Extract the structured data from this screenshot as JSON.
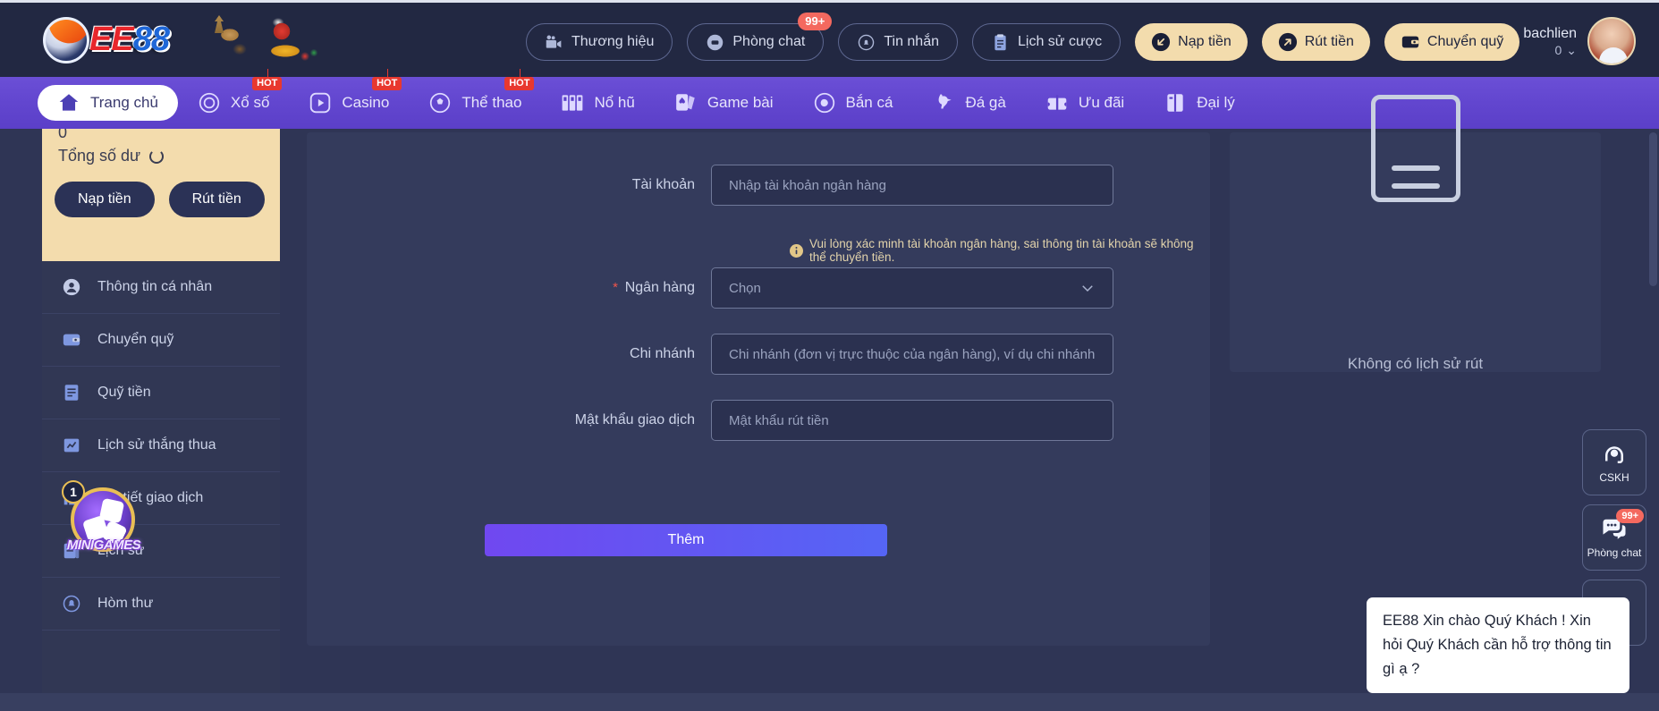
{
  "brand": {
    "name_ee": "EE",
    "name_88": "88"
  },
  "header": {
    "pills": [
      {
        "label": "Thương hiệu",
        "icon": "video-camera-icon",
        "badge": null
      },
      {
        "label": "Phòng chat",
        "icon": "chat-bubble-icon",
        "badge": "99+"
      },
      {
        "label": "Tin nhắn",
        "icon": "bell-icon",
        "badge": null
      },
      {
        "label": "Lịch sử cược",
        "icon": "clipboard-icon",
        "badge": null
      }
    ],
    "gold_buttons": [
      {
        "label": "Nạp tiền",
        "icon": "deposit-arrow-icon"
      },
      {
        "label": "Rút tiền",
        "icon": "withdraw-arrow-icon"
      },
      {
        "label": "Chuyển quỹ",
        "icon": "wallet-icon"
      }
    ],
    "user": {
      "name": "bachlien",
      "balance": "0",
      "caret": "⌄"
    }
  },
  "mainnav": {
    "items": [
      {
        "label": "Trang chủ",
        "icon": "home-icon",
        "active": true,
        "hot": ""
      },
      {
        "label": "Xổ số",
        "icon": "lottery-ball-icon",
        "active": false,
        "hot": "HOT"
      },
      {
        "label": "Casino",
        "icon": "play-circle-icon",
        "active": false,
        "hot": "HOT"
      },
      {
        "label": "Thể thao",
        "icon": "soccer-ball-icon",
        "active": false,
        "hot": "HOT"
      },
      {
        "label": "Nổ hũ",
        "icon": "slot-machine-icon",
        "active": false,
        "hot": ""
      },
      {
        "label": "Game bài",
        "icon": "playing-cards-icon",
        "active": false,
        "hot": ""
      },
      {
        "label": "Bắn cá",
        "icon": "fish-icon",
        "active": false,
        "hot": ""
      },
      {
        "label": "Đá gà",
        "icon": "rooster-icon",
        "active": false,
        "hot": ""
      },
      {
        "label": "Ưu đãi",
        "icon": "gift-ticket-icon",
        "active": false,
        "hot": ""
      },
      {
        "label": "Đại lý",
        "icon": "agent-book-icon",
        "active": false,
        "hot": ""
      }
    ]
  },
  "sidebar": {
    "balance": {
      "amount": "0",
      "label": "Tổng số dư",
      "deposit": "Nạp tiền",
      "withdraw": "Rút tiền"
    },
    "items": [
      {
        "label": "Thông tin cá nhân",
        "icon": "user-circle-icon"
      },
      {
        "label": "Chuyển quỹ",
        "icon": "wallet-icon"
      },
      {
        "label": "Quỹ tiền",
        "icon": "money-list-icon"
      },
      {
        "label": "Lịch sử thắng thua",
        "icon": "win-loss-icon"
      },
      {
        "label": "Chi tiết giao dịch",
        "icon": "transaction-detail-icon"
      },
      {
        "label": "Lịch sử",
        "icon": "history-icon"
      },
      {
        "label": "Hòm thư",
        "icon": "mailbox-icon"
      }
    ],
    "minigame": {
      "label": "MINIGAMES",
      "badge": "1"
    }
  },
  "form": {
    "fields": [
      {
        "label": "Tài khoản",
        "placeholder": "Nhập tài khoản ngân hàng",
        "required": false,
        "type": "text"
      },
      {
        "label": "Ngân hàng",
        "placeholder": "Chọn",
        "required": true,
        "type": "select"
      },
      {
        "label": "Chi nhánh",
        "placeholder": "Chi nhánh (đơn vị trực thuộc của ngân hàng), ví dụ chi nhánh",
        "required": false,
        "type": "text"
      },
      {
        "label": "Mật khẩu giao dịch",
        "placeholder": "Mật khẩu rút tiền",
        "required": false,
        "type": "password"
      }
    ],
    "hint": "Vui lòng xác minh tài khoản ngân hàng, sai thông tin tài khoản sẽ không thể chuyển tiền.",
    "submit": "Thêm"
  },
  "right_panel": {
    "empty_text": "Không có lịch sử rút"
  },
  "float": {
    "buttons": [
      {
        "label": "CSKH",
        "icon": "headset-icon",
        "badge": null
      },
      {
        "label": "Phòng chat",
        "icon": "chat-bubbles-icon",
        "badge": "99+"
      },
      {
        "label": "",
        "icon": "telegram-icon",
        "badge": null
      }
    ],
    "chat_message": "EE88 Xin chào Quý Khách ! Xin hỏi Quý Khách cần hỗ trợ thông tin gì ạ ?"
  }
}
